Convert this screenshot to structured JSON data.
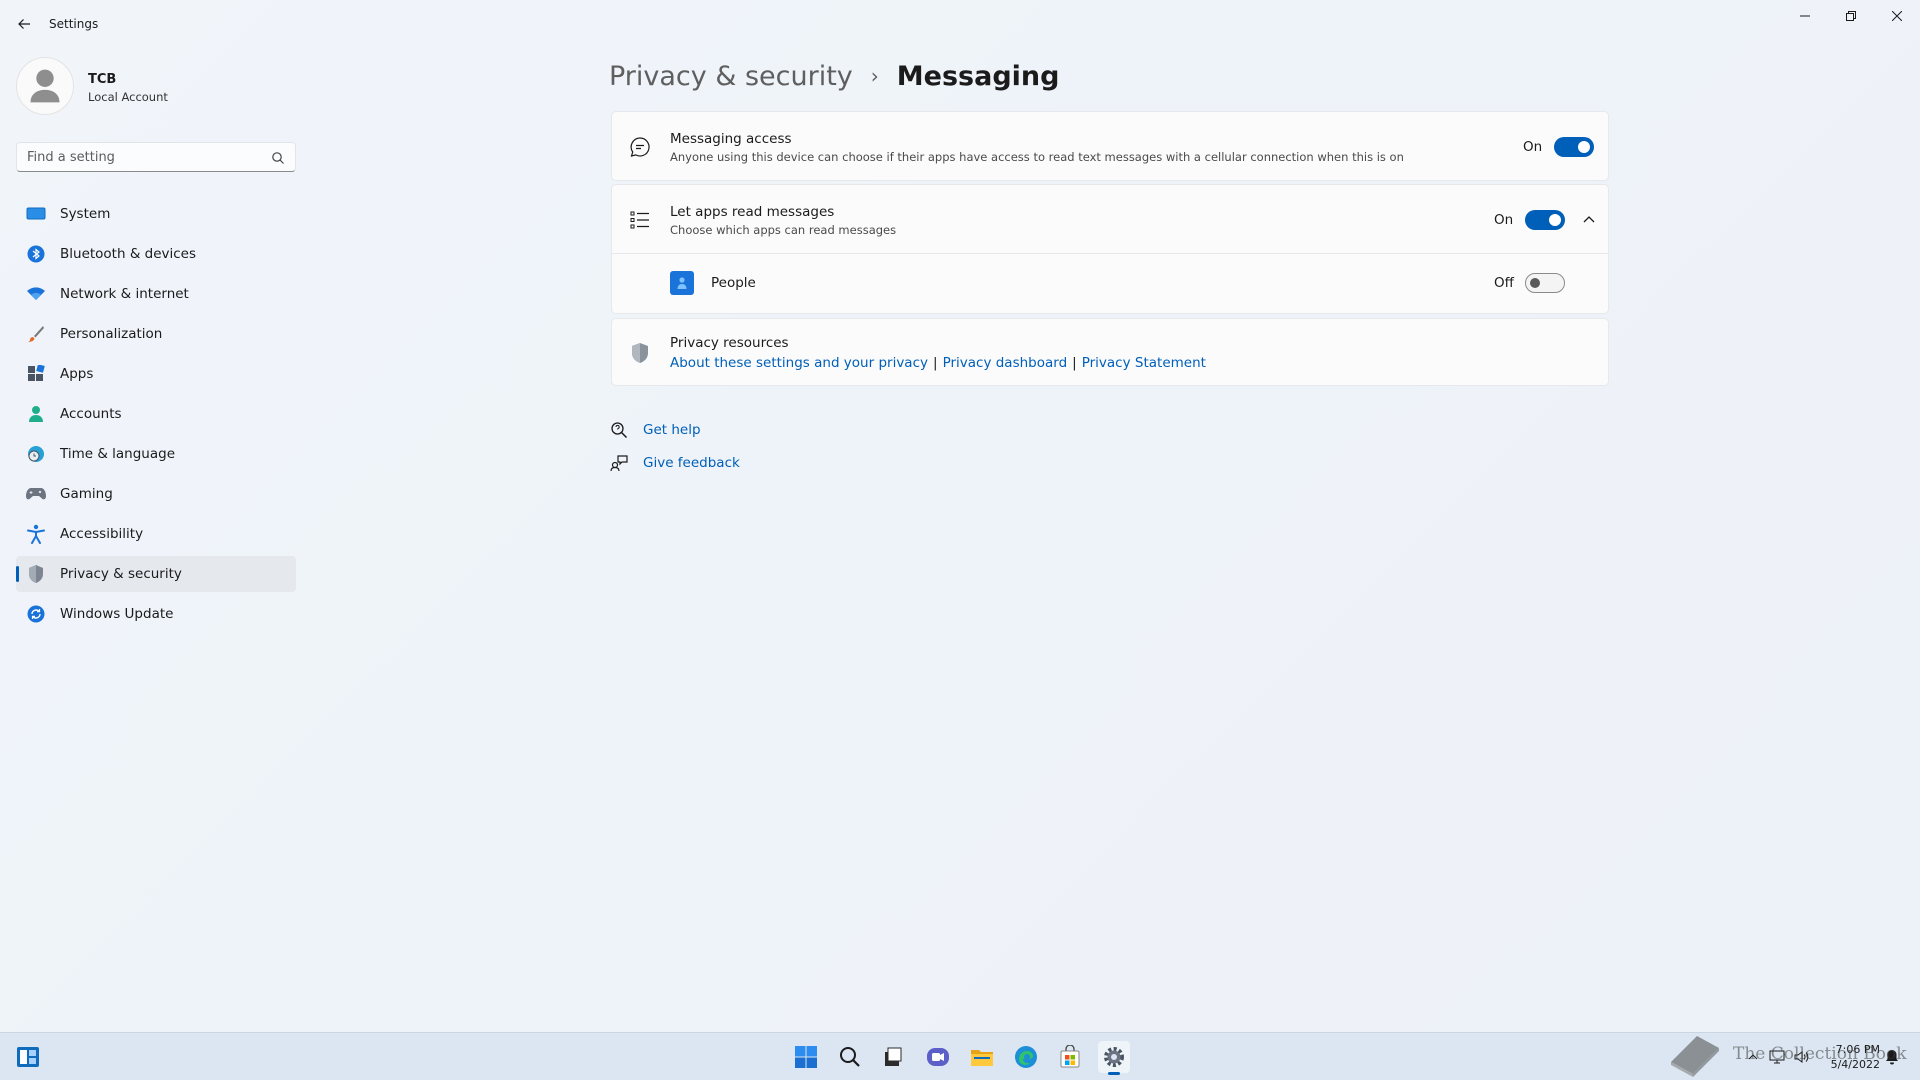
{
  "window": {
    "title": "Settings"
  },
  "user": {
    "name": "TCB",
    "account_type": "Local Account"
  },
  "search": {
    "placeholder": "Find a setting"
  },
  "sidebar": {
    "items": [
      {
        "label": "System",
        "icon": "system-icon"
      },
      {
        "label": "Bluetooth & devices",
        "icon": "bluetooth-icon"
      },
      {
        "label": "Network & internet",
        "icon": "wifi-icon"
      },
      {
        "label": "Personalization",
        "icon": "brush-icon"
      },
      {
        "label": "Apps",
        "icon": "apps-icon"
      },
      {
        "label": "Accounts",
        "icon": "person-icon"
      },
      {
        "label": "Time & language",
        "icon": "globe-clock-icon"
      },
      {
        "label": "Gaming",
        "icon": "gamepad-icon"
      },
      {
        "label": "Accessibility",
        "icon": "accessibility-icon"
      },
      {
        "label": "Privacy & security",
        "icon": "shield-icon",
        "active": true
      },
      {
        "label": "Windows Update",
        "icon": "update-icon"
      }
    ]
  },
  "breadcrumb": {
    "parent": "Privacy & security",
    "separator": "›",
    "current": "Messaging"
  },
  "messaging_access": {
    "title": "Messaging access",
    "description": "Anyone using this device can choose if their apps have access to read text messages with a cellular connection when this is on",
    "state": "On"
  },
  "apps_read": {
    "title": "Let apps read messages",
    "description": "Choose which apps can read messages",
    "state": "On"
  },
  "apps": [
    {
      "name": "People",
      "state": "Off"
    }
  ],
  "privacy_resources": {
    "title": "Privacy resources",
    "links": [
      "About these settings and your privacy",
      "Privacy dashboard",
      "Privacy Statement"
    ],
    "separator": "|"
  },
  "help": {
    "get_help": "Get help",
    "give_feedback": "Give feedback"
  },
  "taskbar": {
    "time": "7:06 PM",
    "date": "5/4/2022"
  },
  "watermark": {
    "text": "The Collection Book"
  },
  "colors": {
    "accent": "#005fb8",
    "background": "#eef3f9",
    "card": "#fbfbfc"
  }
}
